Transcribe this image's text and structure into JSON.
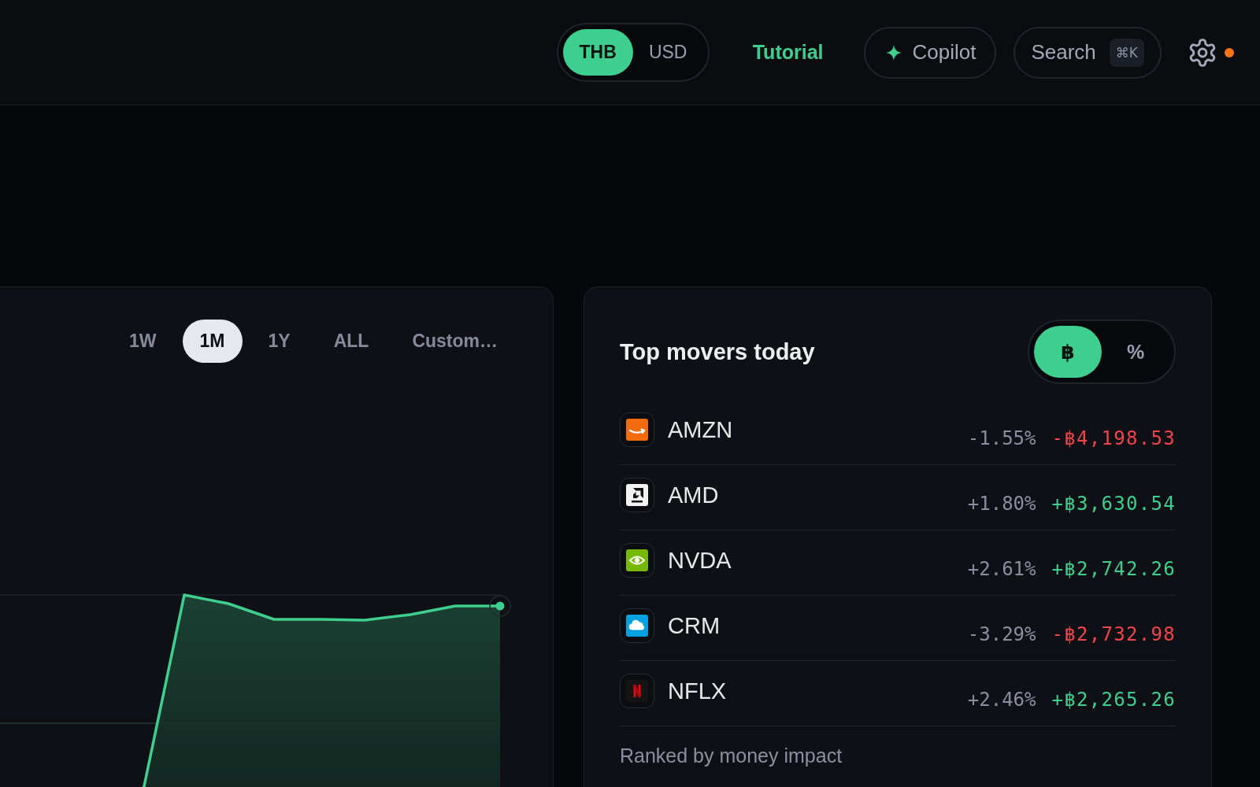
{
  "header": {
    "currency_toggle": [
      {
        "label": "THB",
        "selected": true
      },
      {
        "label": "USD",
        "selected": false
      }
    ],
    "tutorial_link": "Tutorial",
    "copilot_button": "Copilot",
    "search": {
      "label": "Search",
      "shortcut": "⌘K"
    },
    "settings": {
      "notification": true
    }
  },
  "chart_card": {
    "ranges": [
      {
        "label": "1W",
        "selected": false
      },
      {
        "label": "1M",
        "selected": true
      },
      {
        "label": "1Y",
        "selected": false
      },
      {
        "label": "ALL",
        "selected": false
      },
      {
        "label": "Custom…",
        "selected": false
      }
    ]
  },
  "movers": {
    "title": "Top movers today",
    "mode_toggle": [
      {
        "label": "฿",
        "selected": true
      },
      {
        "label": "%",
        "selected": false
      }
    ],
    "rows": [
      {
        "ticker": "AMZN",
        "kind": "smile",
        "color": "#f26b0f",
        "change_pct": "-1.55%",
        "change_amount": "-฿4,198.53",
        "gain": false
      },
      {
        "ticker": "AMD",
        "kind": "arrow",
        "color": "#f2f2f2",
        "change_pct": "+1.80%",
        "change_amount": "+฿3,630.54",
        "gain": true
      },
      {
        "ticker": "NVDA",
        "kind": "eye",
        "color": "#76b900",
        "change_pct": "+2.61%",
        "change_amount": "+฿2,742.26",
        "gain": true
      },
      {
        "ticker": "CRM",
        "kind": "cloud",
        "color": "#00a1e0",
        "change_pct": "-3.29%",
        "change_amount": "-฿2,732.98",
        "gain": false
      },
      {
        "ticker": "NFLX",
        "kind": "ribbon",
        "color": "#141414",
        "change_pct": "+2.46%",
        "change_amount": "+฿2,265.26",
        "gain": true
      }
    ],
    "footnote": "Ranked by money impact"
  }
}
